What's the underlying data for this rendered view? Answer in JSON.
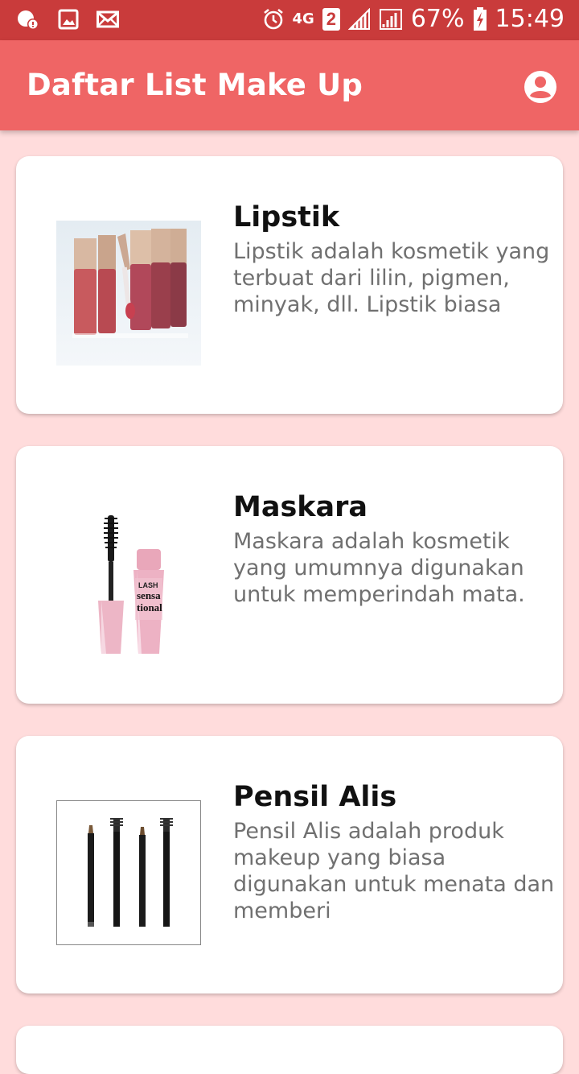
{
  "status_bar": {
    "battery": "67%",
    "time": "15:49",
    "network": "4G",
    "sim_slot": "2"
  },
  "app_bar": {
    "title": "Daftar List Make Up",
    "account_icon": "account-circle-icon"
  },
  "items": [
    {
      "title": "Lipstik",
      "description": "Lipstik adalah kosmetik yang terbuat dari lilin, pigmen, minyak, dll. Lipstik biasa",
      "image": "lipstick-image"
    },
    {
      "title": "Maskara",
      "description": "Maskara adalah kosmetik yang umumnya digunakan untuk memperindah mata.",
      "image": "mascara-image"
    },
    {
      "title": "Pensil Alis",
      "description": "Pensil Alis adalah produk makeup yang biasa digunakan untuk menata dan memberi",
      "image": "eyebrow-pencil-image"
    }
  ],
  "colors": {
    "status_bar": "#C93B3B",
    "app_bar": "#EF6565",
    "background": "#FFDCDC",
    "card": "#FFFFFF",
    "title_text": "#111111",
    "desc_text": "#707070"
  }
}
